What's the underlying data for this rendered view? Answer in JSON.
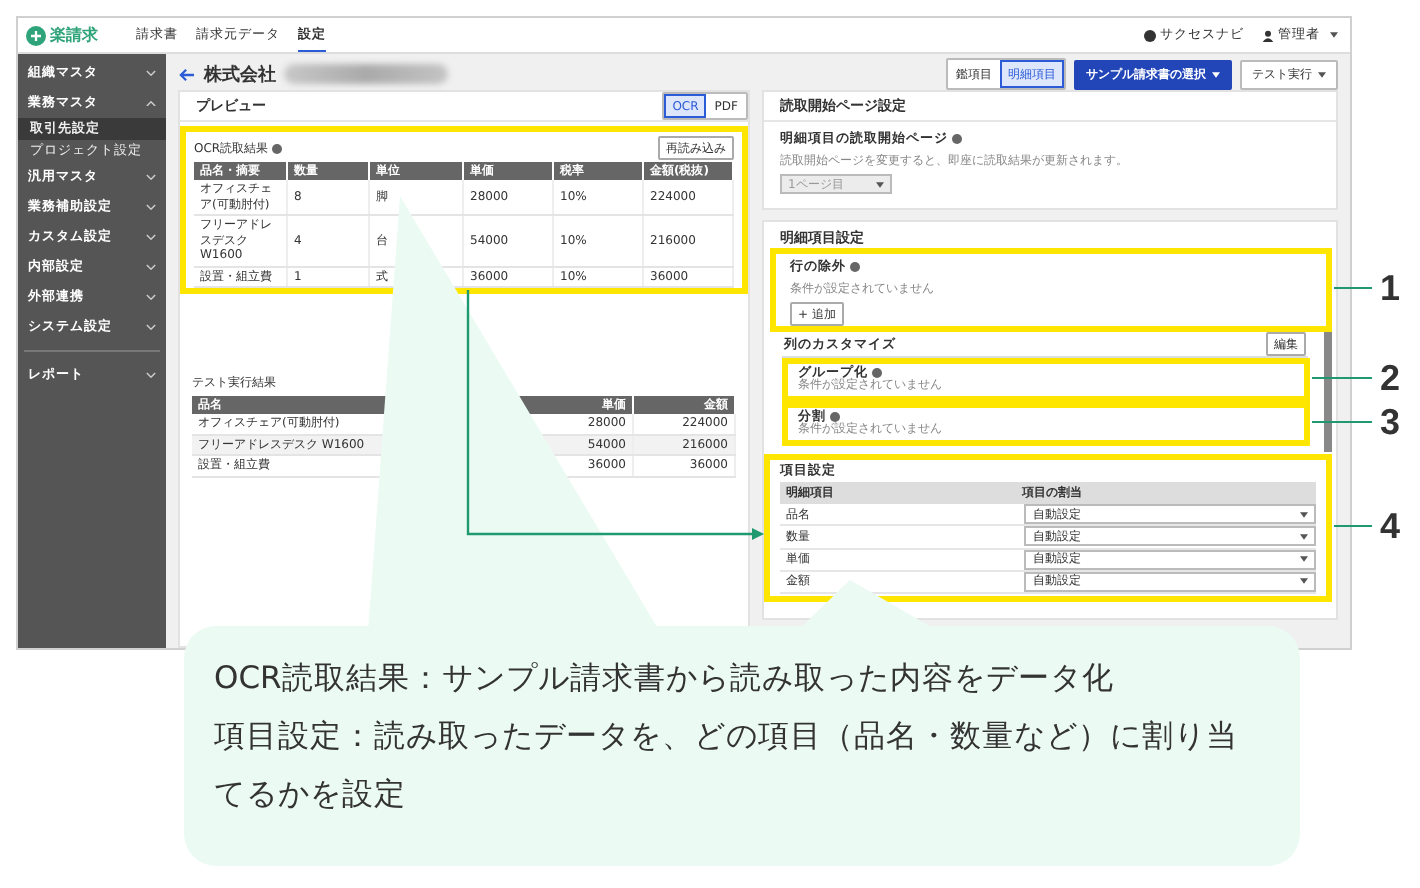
{
  "app": {
    "logo": "楽請求",
    "nav_tabs": [
      {
        "label": "請求書",
        "selected": false
      },
      {
        "label": "請求元データ",
        "selected": false
      },
      {
        "label": "設定",
        "selected": true
      }
    ],
    "header_links": [
      {
        "label": "サクセスナビ",
        "kind": "help"
      },
      {
        "label": "管理者",
        "kind": "user"
      }
    ],
    "sidebar": {
      "items": [
        {
          "label": "組織マスタ",
          "expanded": false
        },
        {
          "label": "業務マスタ",
          "expanded": true,
          "children": [
            {
              "label": "取引先設定",
              "selected": true
            },
            {
              "label": "プロジェクト設定",
              "selected": false
            }
          ]
        },
        {
          "label": "汎用マスタ",
          "expanded": false
        },
        {
          "label": "業務補助設定",
          "expanded": false
        },
        {
          "label": "カスタム設定",
          "expanded": false
        },
        {
          "label": "内部設定",
          "expanded": false
        },
        {
          "label": "外部連携",
          "expanded": false
        },
        {
          "label": "システム設定",
          "expanded": false
        }
      ],
      "footer_items": [
        {
          "label": "レポート",
          "expanded": false
        }
      ]
    },
    "page_title": "株式会社",
    "view_toggle": [
      {
        "label": "鑑項目",
        "selected": false
      },
      {
        "label": "明細項目",
        "selected": true
      }
    ],
    "actions": [
      {
        "label": "サンプル請求書の選択",
        "kind": "primary"
      },
      {
        "label": "テスト実行",
        "kind": "default"
      }
    ],
    "preview": {
      "title": "プレビュー",
      "mode_toggle": [
        {
          "label": "OCR",
          "selected": true
        },
        {
          "label": "PDF",
          "selected": false
        }
      ],
      "ocr_result": {
        "title": "OCR読取結果",
        "reload_button": "再読み込み",
        "columns": [
          "品名・摘要",
          "数量",
          "単位",
          "単価",
          "税率",
          "金額(税抜)"
        ],
        "rows": [
          [
            "オフィスチェア(可動肘付)",
            "8",
            "脚",
            "28000",
            "10%",
            "224000"
          ],
          [
            "フリーアドレスデスク W1600",
            "4",
            "台",
            "54000",
            "10%",
            "216000"
          ],
          [
            "設置・組立費",
            "1",
            "式",
            "36000",
            "10%",
            "36000"
          ]
        ]
      },
      "test_result": {
        "title": "テスト実行結果",
        "columns": [
          "品名",
          "単価",
          "金額"
        ],
        "rows": [
          [
            "オフィスチェア(可動肘付)",
            "28000",
            "224000"
          ],
          [
            "フリーアドレスデスク W1600",
            "54000",
            "216000"
          ],
          [
            "設置・組立費",
            "36000",
            "36000"
          ]
        ]
      }
    },
    "start_page": {
      "title": "読取開始ページ設定",
      "label": "明細項目の読取開始ページ",
      "hint": "読取開始ページを変更すると、即座に読取結果が更新されます。",
      "select": {
        "value": "1ページ目",
        "disabled": true
      }
    },
    "detail_settings": {
      "title": "明細項目設定",
      "row_exclusion": {
        "label": "行の除外",
        "status": "条件が設定されていません",
        "add_button": "+ 追加"
      },
      "column_customize": {
        "label": "列のカスタマイズ",
        "edit_button": "編集"
      },
      "grouping": {
        "label": "グループ化",
        "status": "条件が設定されていません"
      },
      "split": {
        "label": "分割",
        "status": "条件が設定されていません"
      },
      "item_settings": {
        "title": "項目設定",
        "columns": [
          "明細項目",
          "項目の割当"
        ],
        "rows": [
          {
            "name": "品名",
            "assignment": "自動設定"
          },
          {
            "name": "数量",
            "assignment": "自動設定"
          },
          {
            "name": "単価",
            "assignment": "自動設定"
          },
          {
            "name": "金額",
            "assignment": "自動設定"
          }
        ]
      }
    }
  },
  "annotations": {
    "numbers": [
      "1",
      "2",
      "3",
      "4"
    ],
    "note_lines": [
      "OCR読取結果：サンプル請求書から読み取った内容をデータ化",
      "項目設定：読み取ったデータを、どの項目（品名・数量など）に割り当てるかを設定"
    ]
  }
}
